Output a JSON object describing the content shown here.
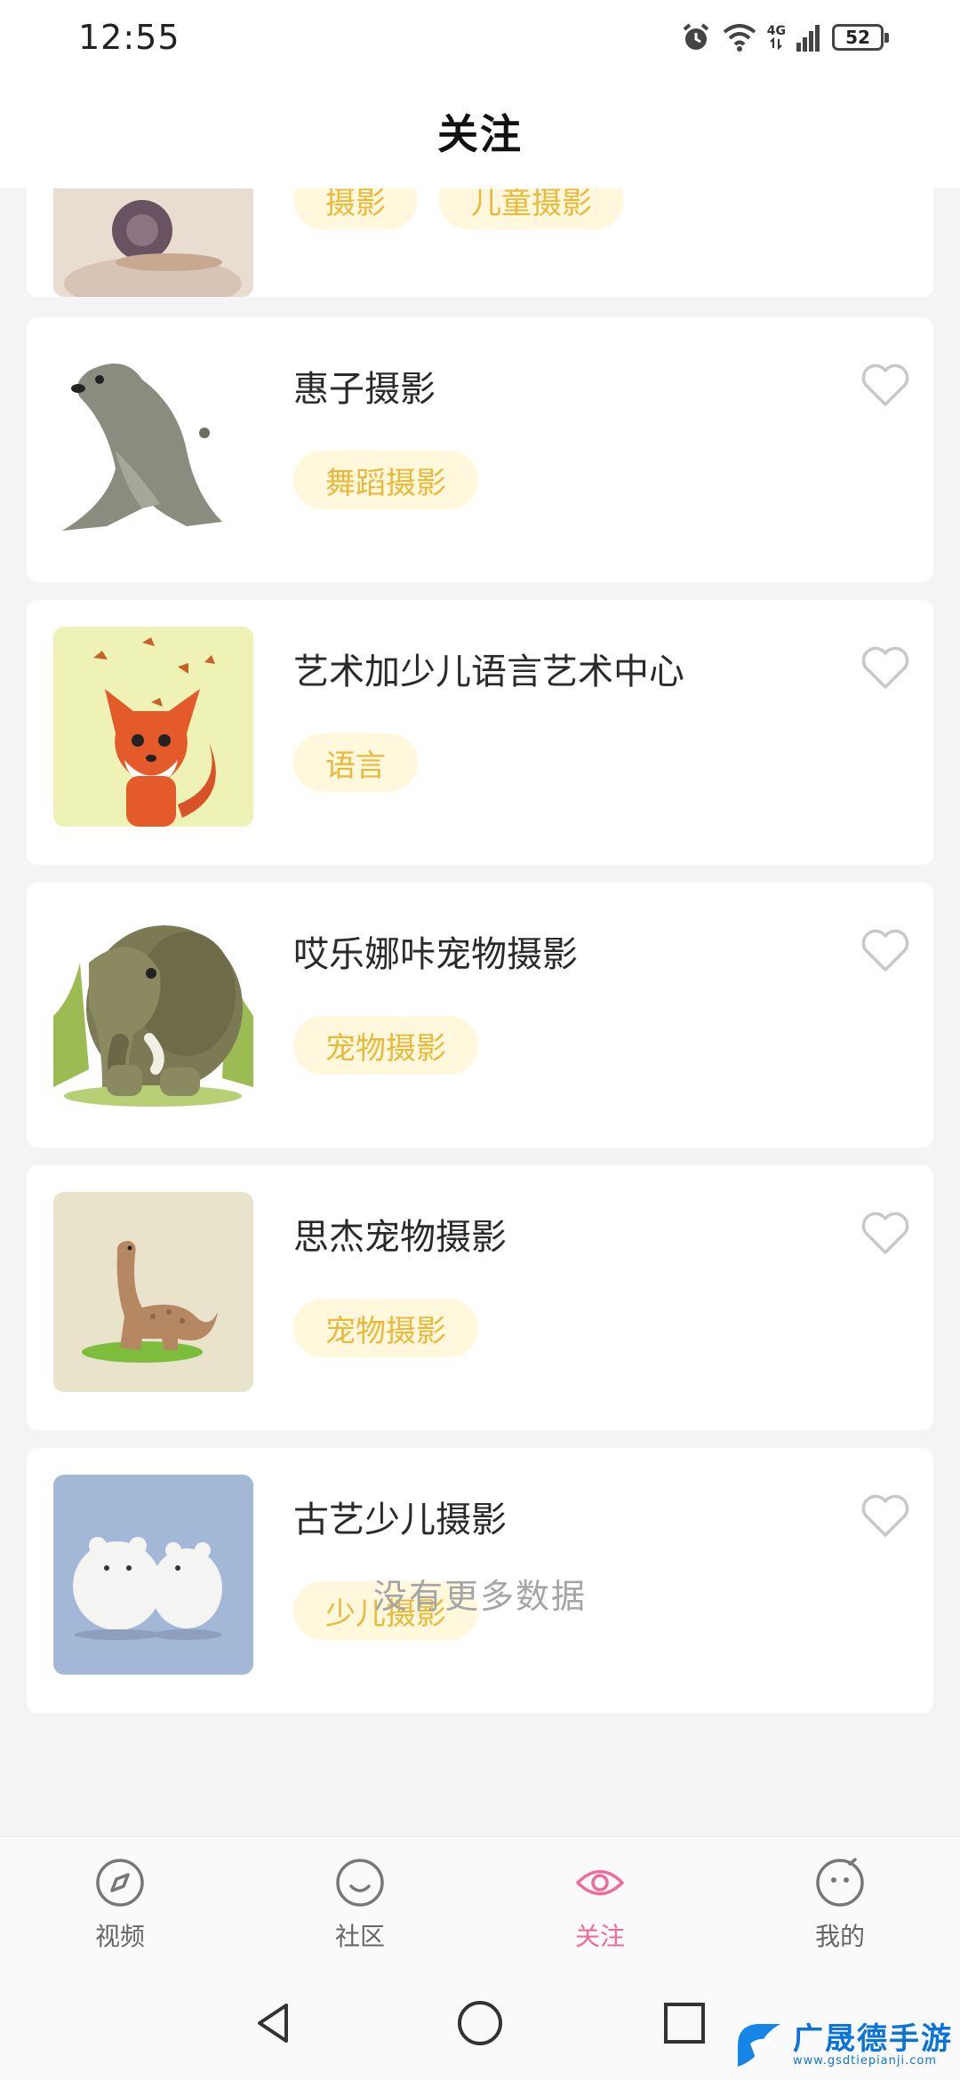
{
  "status_bar": {
    "time": "12:55",
    "network": "4G",
    "battery": "52"
  },
  "header": {
    "title": "关注"
  },
  "cards": [
    {
      "title": "",
      "tags": [
        "摄影",
        "儿童摄影"
      ]
    },
    {
      "title": "惠子摄影",
      "tags": [
        "舞蹈摄影"
      ]
    },
    {
      "title": "艺术加少儿语言艺术中心",
      "tags": [
        "语言"
      ]
    },
    {
      "title": "哎乐娜咔宠物摄影",
      "tags": [
        "宠物摄影"
      ]
    },
    {
      "title": "思杰宠物摄影",
      "tags": [
        "宠物摄影"
      ]
    },
    {
      "title": "古艺少儿摄影",
      "tags": [
        "少儿摄影"
      ]
    }
  ],
  "list_end": "没有更多数据",
  "bottom_nav": [
    {
      "label": "视频",
      "icon": "compass-icon"
    },
    {
      "label": "社区",
      "icon": "smiley-icon"
    },
    {
      "label": "关注",
      "icon": "eye-icon",
      "active": true
    },
    {
      "label": "我的",
      "icon": "face-icon"
    }
  ],
  "watermark": {
    "text": "广晟德手游",
    "url": "www.gsdtiepianji.com"
  },
  "colors": {
    "accent": "#f06a9c",
    "tag_text": "#e8b93a",
    "tag_bg": "#fff8dc"
  }
}
